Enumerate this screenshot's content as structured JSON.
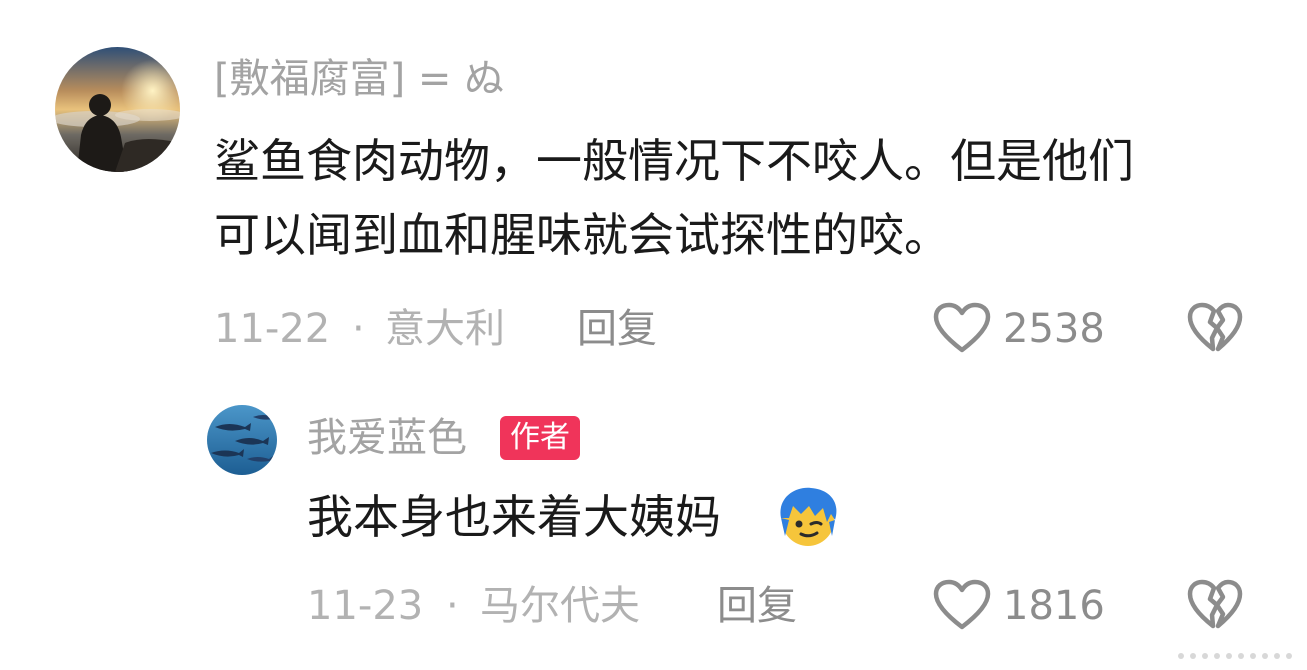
{
  "comments": [
    {
      "username": "[敷福腐富] = ぬ",
      "text_lines": [
        "鲨鱼食肉动物，一般情况下不咬人。但是他们",
        "可以闻到血和腥味就会试探性的咬。"
      ],
      "date": "11-22",
      "separator": "·",
      "location": "意大利",
      "reply_label": "回复",
      "like_count": "2538",
      "avatar_icon": "sunset-silhouette-avatar",
      "like_icon": "heart-outline-icon",
      "dislike_icon": "broken-heart-icon"
    },
    {
      "username": "我爱蓝色",
      "badge": "作者",
      "text": "我本身也来着大姨妈",
      "emoji": "blue-hair-smirk-emoji",
      "date": "11-23",
      "separator": "·",
      "location": "马尔代夫",
      "reply_label": "回复",
      "like_count": "1816",
      "avatar_icon": "fish-school-avatar",
      "like_icon": "heart-outline-icon",
      "dislike_icon": "broken-heart-icon"
    }
  ],
  "colors": {
    "badge_bg": "#f0345a",
    "username": "#a3a3a3",
    "text": "#1a1a1a",
    "meta": "#b2b2b2"
  }
}
